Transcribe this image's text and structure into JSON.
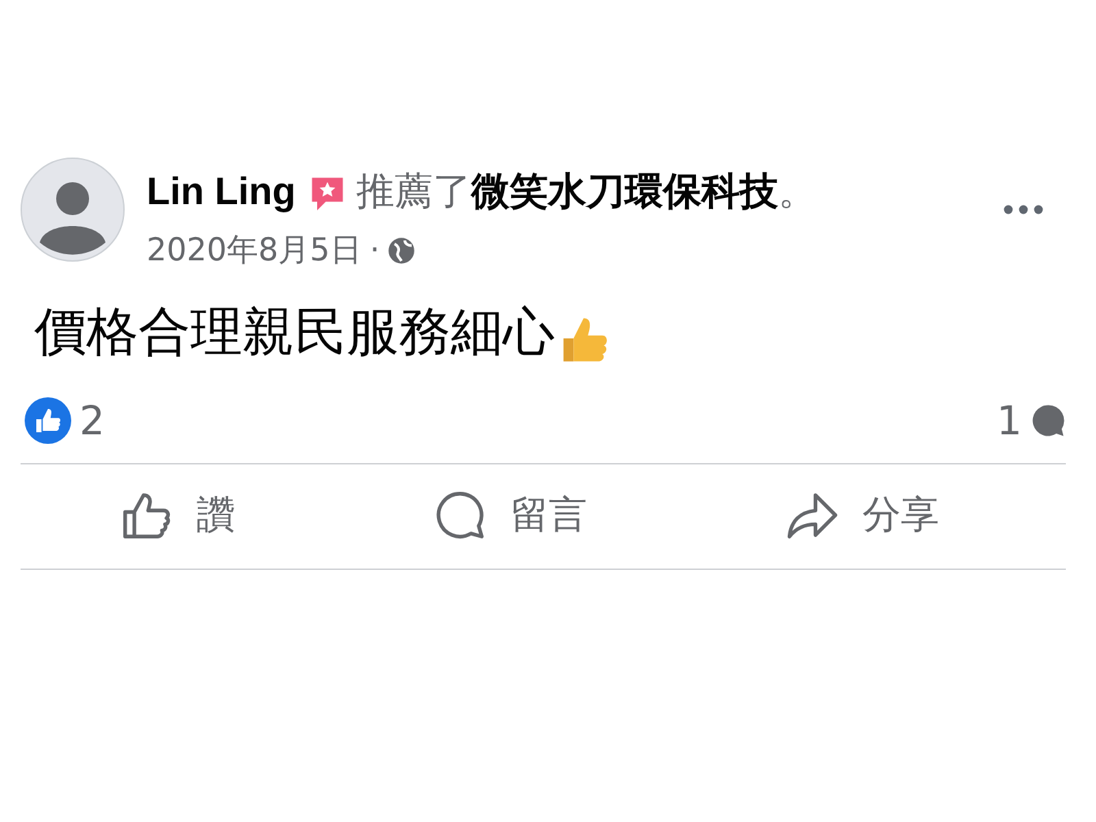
{
  "post": {
    "author": "Lin Ling",
    "action": "推薦了**微笑水刀環保科技**。",
    "date": "2020年8月5日",
    "separator": "·",
    "text": "價格合理親民服務細心"
  },
  "stats": {
    "likes": "2",
    "comments": "1"
  },
  "actions": [
    {
      "kind": "like",
      "label": "讚"
    },
    {
      "kind": "comment",
      "label": "留言"
    },
    {
      "kind": "share",
      "label": "分享"
    }
  ]
}
